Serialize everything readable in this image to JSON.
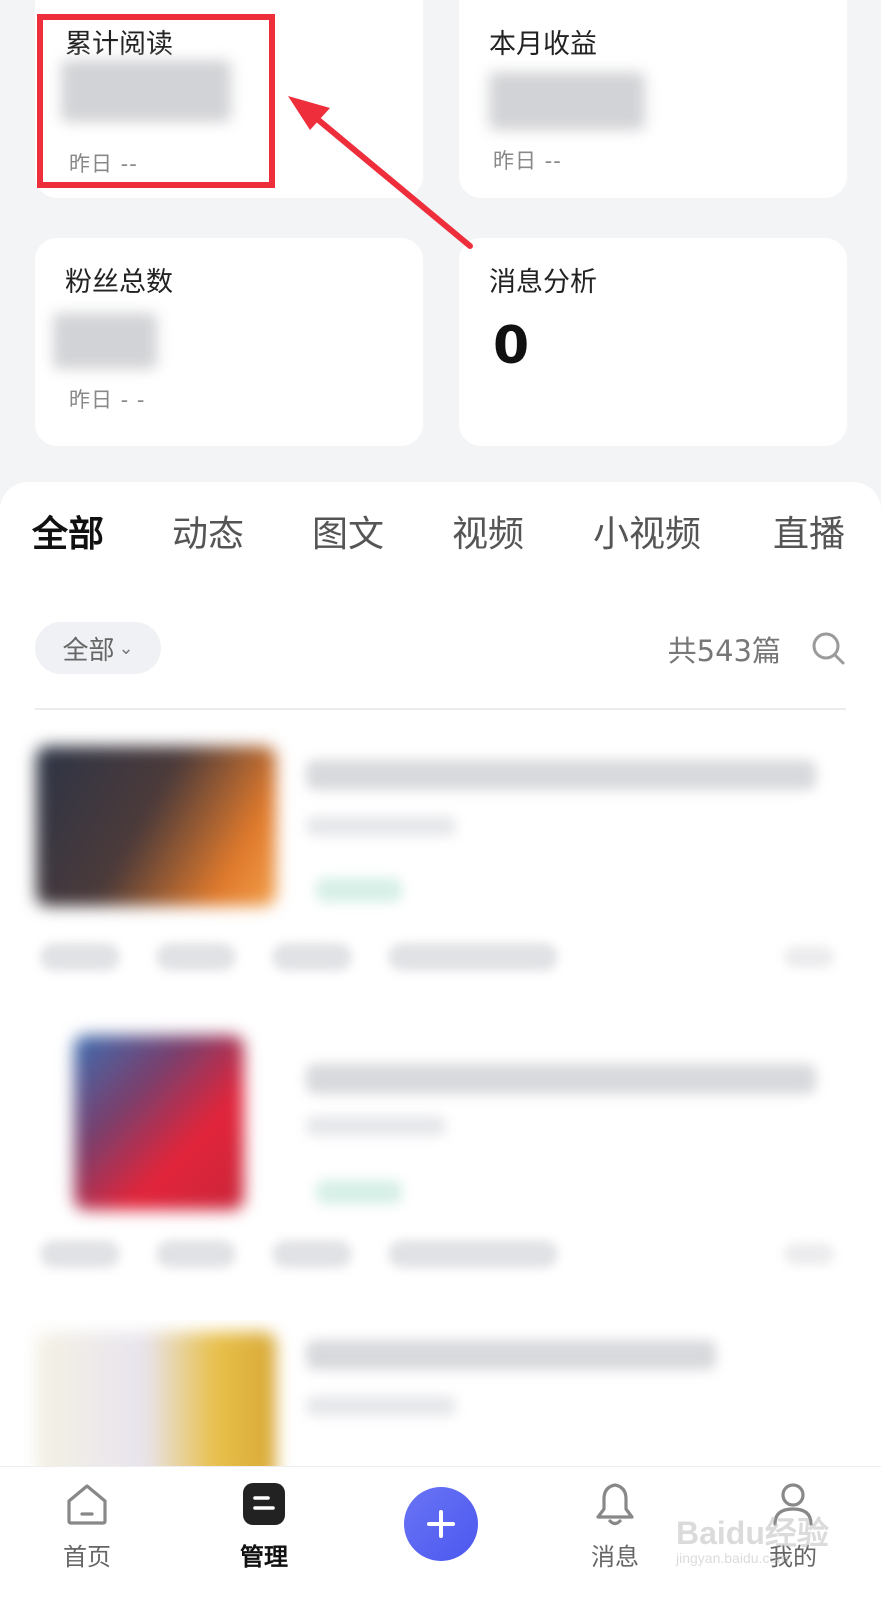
{
  "stats": {
    "cumulative_reads": {
      "title": "累计阅读",
      "yesterday": "昨日 --"
    },
    "monthly_income": {
      "title": "本月收益",
      "yesterday": "昨日 --"
    },
    "total_fans": {
      "title": "粉丝总数",
      "yesterday": "昨日 - -"
    },
    "message_analysis": {
      "title": "消息分析",
      "value": "0"
    }
  },
  "annotation": {
    "color": "#ee2f3b"
  },
  "tabs": [
    "全部",
    "动态",
    "图文",
    "视频",
    "小视频",
    "直播"
  ],
  "filter": {
    "selected": "全部"
  },
  "count_label": "共543篇",
  "bottom_nav": {
    "home": "首页",
    "manage": "管理",
    "messages": "消息",
    "me": "我的"
  },
  "watermark": {
    "brand": "Baidu经验",
    "url": "jingyan.baidu.com"
  },
  "colors": {
    "accent": "#4b58ee",
    "page_bg": "#f3f4f6"
  }
}
